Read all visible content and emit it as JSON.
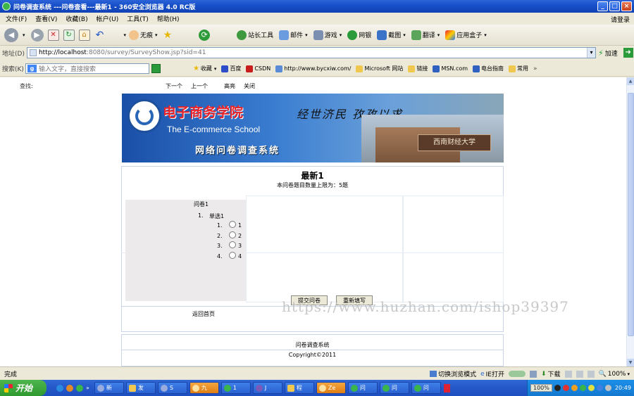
{
  "window": {
    "title": "问卷调查系统 ---问卷查看---最新1 - 360安全浏览器 4.0 RC版",
    "controls": [
      "_",
      "□",
      "×"
    ]
  },
  "menu": {
    "items": [
      "文件(F)",
      "查看(V)",
      "收藏(B)",
      "帐户(U)",
      "工具(T)",
      "帮助(H)"
    ],
    "login": "请登录"
  },
  "toolbar": {
    "no_image": "无痕",
    "webmaster_tools": "站长工具",
    "mail": "邮件",
    "games": "游戏",
    "online_banking": "网银",
    "screenshot": "截图",
    "translate": "翻译",
    "app_box": "应用盒子"
  },
  "address": {
    "label": "地址(D)",
    "url_host": "http://localhost",
    "url_rest": ":8080/survey/SurveyShow.jsp?sid=41",
    "accelerate": "加速"
  },
  "search": {
    "label": "搜索(K)",
    "placeholder": "输入文字，直接搜索"
  },
  "favorites": {
    "label": "收藏",
    "items": [
      "百度",
      "CSDN",
      "http://www.bycxiw.com/",
      "Microsoft 网站",
      "链接",
      "MSN.com",
      "电台指南",
      "常用"
    ],
    "more": "»"
  },
  "page": {
    "search_label": "查找:",
    "nav": {
      "next": "下一个",
      "prev": "上一个",
      "highlight": "高亮",
      "close": "关闭"
    },
    "banner": {
      "title_cn": "电子商务学院",
      "slogan": "经世济民  孜孜以求",
      "title_en": "The E-commerce School",
      "system_name": "网络问卷调查系统",
      "university": "西南财经大学"
    },
    "survey": {
      "title": "最新1",
      "limit_text": "本问卷题目数量上限为：5题",
      "name": "问卷1",
      "question_number": "1.",
      "question_title": "单选1",
      "options": [
        {
          "num": "1.",
          "label": "1"
        },
        {
          "num": "2.",
          "label": "2"
        },
        {
          "num": "3.",
          "label": "3"
        },
        {
          "num": "4.",
          "label": "4"
        }
      ],
      "submit_label": "提交问卷",
      "reset_label": "重新填写",
      "back_link": "返回首页"
    },
    "footer": {
      "system_name": "问卷调查系统",
      "copyright": "Copyright©2011"
    },
    "watermark": "https://www.huzhan.com/ishop39397"
  },
  "status": {
    "text": "完成",
    "view_mode": "切换浏览模式",
    "open": "IE打开",
    "download": "下载",
    "zoom": "100%"
  },
  "taskbar": {
    "start": "开始",
    "tasks": [
      {
        "label": "新",
        "active": false
      },
      {
        "label": "发",
        "active": false
      },
      {
        "label": "S",
        "active": false
      },
      {
        "label": "九",
        "active": true
      },
      {
        "label": "1",
        "active": false
      },
      {
        "label": "J",
        "active": false
      },
      {
        "label": "程",
        "active": false
      },
      {
        "label": "Ze",
        "active": true
      },
      {
        "label": "问",
        "active": false
      },
      {
        "label": "问",
        "active": false
      },
      {
        "label": "问",
        "active": false
      }
    ],
    "battery": "100%",
    "clock": "20:49"
  },
  "colors": {
    "titlebar": "#1750C9",
    "taskbar": "#2457C8",
    "start_button": "#3A9F3A",
    "panel_border": "#C9D6EC",
    "watermark": "#BFBFBF"
  }
}
